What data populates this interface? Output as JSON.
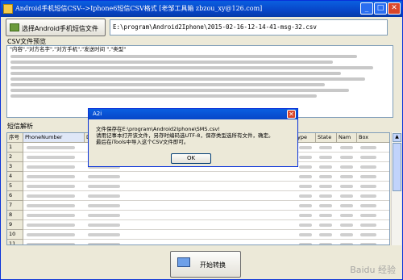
{
  "window": {
    "title": "Android手机短信CSV-->Iphone6短信CSV格式  [老邹工具箱 zbzou_xy@126.com]"
  },
  "toolbar": {
    "select_button": "选择Android手机短信文件",
    "path": "E:\\program\\Android2Iphone\\2015-02-16-12-14-41-msg-32.csv"
  },
  "preview": {
    "label": "CSV文件预览",
    "first_line": "\"内容\",\"对方名字\",\"对方手机\",\"发送时间 \",\"类型\""
  },
  "sms": {
    "label": "短信解析",
    "columns": [
      "序号",
      "PhoneNumber",
      "Da",
      "ype",
      "State",
      "Nam",
      "Box"
    ],
    "row_numbers": [
      "1",
      "2",
      "3",
      "4",
      "5",
      "6",
      "7",
      "8",
      "9",
      "10",
      "11"
    ]
  },
  "dialog": {
    "title": "A2i",
    "line1": "文件保存在E:\\program\\Android2Iphone\\SMS.csv!",
    "line2": "请用记事本打开该文件，另存时编码选UTF-8，保存类型选所有文件，确定。",
    "line3": "最后在iTools中导入这个CSV文件即可。",
    "ok": "OK"
  },
  "convert": {
    "label": "开始转换"
  },
  "watermark": "Baidu 经验"
}
